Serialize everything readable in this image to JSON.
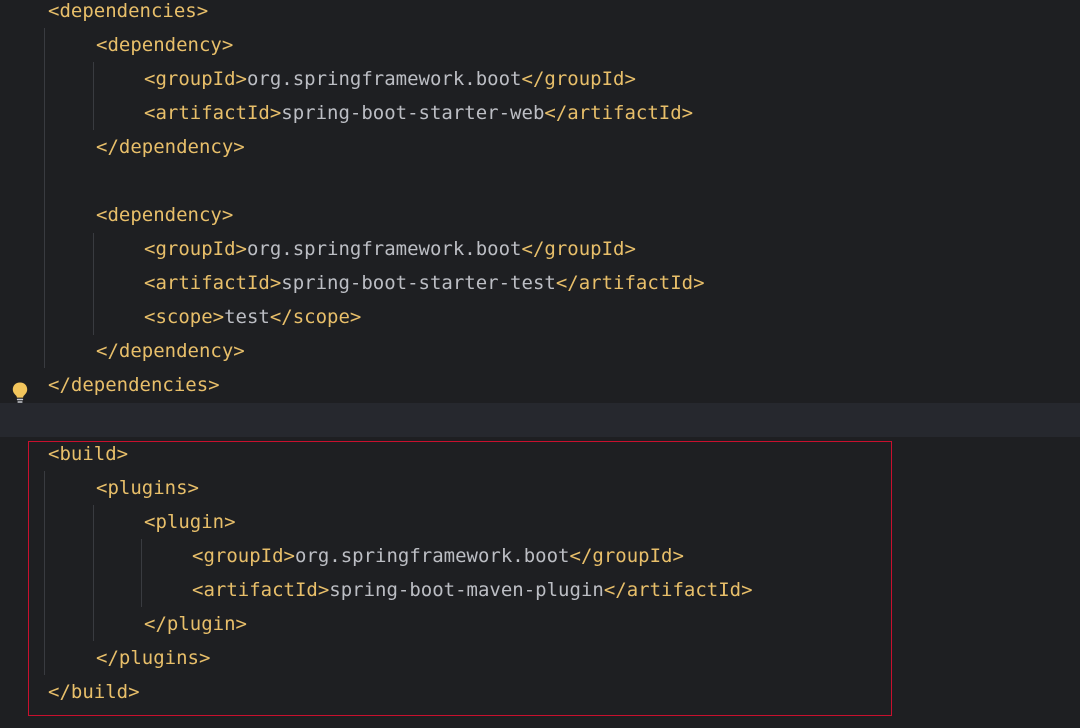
{
  "editor": {
    "lines": [
      {
        "id": "l0",
        "indent": 0,
        "tag_open": "<dependencies>",
        "text": "",
        "tag_close": ""
      },
      {
        "id": "l1",
        "indent": 1,
        "tag_open": "<dependency>",
        "text": "",
        "tag_close": ""
      },
      {
        "id": "l2",
        "indent": 2,
        "tag_open": "<groupId>",
        "text": "org.springframework.boot",
        "tag_close": "</groupId>"
      },
      {
        "id": "l3",
        "indent": 2,
        "tag_open": "<artifactId>",
        "text": "spring-boot-starter-web",
        "tag_close": "</artifactId>"
      },
      {
        "id": "l4",
        "indent": 1,
        "tag_open": "</dependency>",
        "text": "",
        "tag_close": ""
      },
      {
        "id": "l5",
        "indent": 0,
        "tag_open": "",
        "text": "",
        "tag_close": ""
      },
      {
        "id": "l6",
        "indent": 1,
        "tag_open": "<dependency>",
        "text": "",
        "tag_close": ""
      },
      {
        "id": "l7",
        "indent": 2,
        "tag_open": "<groupId>",
        "text": "org.springframework.boot",
        "tag_close": "</groupId>"
      },
      {
        "id": "l8",
        "indent": 2,
        "tag_open": "<artifactId>",
        "text": "spring-boot-starter-test",
        "tag_close": "</artifactId>"
      },
      {
        "id": "l9",
        "indent": 2,
        "tag_open": "<scope>",
        "text": "test",
        "tag_close": "</scope>"
      },
      {
        "id": "l10",
        "indent": 1,
        "tag_open": "</dependency>",
        "text": "",
        "tag_close": ""
      },
      {
        "id": "l11",
        "indent": 0,
        "tag_open": "</dependencies>",
        "text": "",
        "tag_close": ""
      },
      {
        "id": "l12",
        "indent": 0,
        "tag_open": "",
        "text": "",
        "tag_close": ""
      },
      {
        "id": "l13",
        "indent": 0,
        "tag_open": "<build>",
        "text": "",
        "tag_close": ""
      },
      {
        "id": "l14",
        "indent": 1,
        "tag_open": "<plugins>",
        "text": "",
        "tag_close": ""
      },
      {
        "id": "l15",
        "indent": 2,
        "tag_open": "<plugin>",
        "text": "",
        "tag_close": ""
      },
      {
        "id": "l16",
        "indent": 3,
        "tag_open": "<groupId>",
        "text": "org.springframework.boot",
        "tag_close": "</groupId>"
      },
      {
        "id": "l17",
        "indent": 3,
        "tag_open": "<artifactId>",
        "text": "spring-boot-maven-plugin",
        "tag_close": "</artifactId>"
      },
      {
        "id": "l18",
        "indent": 2,
        "tag_open": "</plugin>",
        "text": "",
        "tag_close": ""
      },
      {
        "id": "l19",
        "indent": 1,
        "tag_open": "</plugins>",
        "text": "",
        "tag_close": ""
      },
      {
        "id": "l20",
        "indent": 0,
        "tag_open": "</build>",
        "text": "",
        "tag_close": ""
      }
    ],
    "caret_line": "l12",
    "intention_icon": "lightbulb-icon",
    "colors": {
      "background": "#1e1f22",
      "tag": "#e8bf6a",
      "text": "#bcbec4",
      "highlight_box": "#c8102e",
      "bulb": "#f2c55c"
    }
  }
}
